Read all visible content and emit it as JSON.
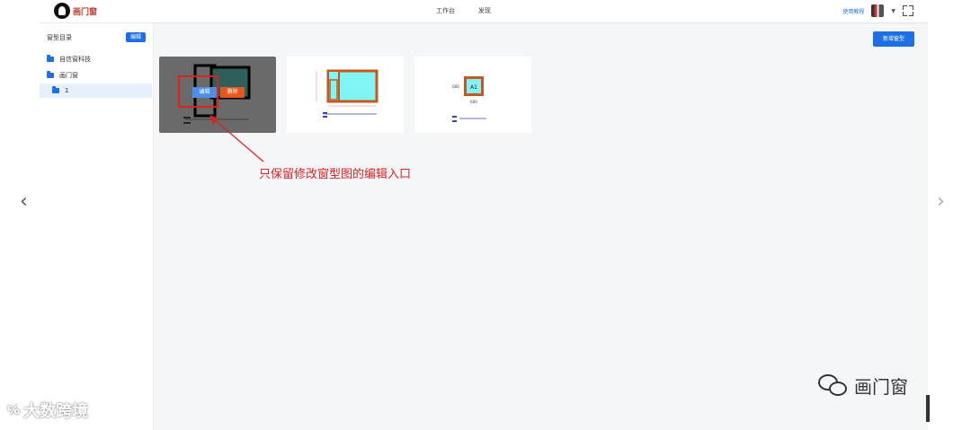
{
  "header": {
    "logo_text": "画门窗",
    "nav": [
      "工作台",
      "发现"
    ],
    "tutorial_link": "使用教程"
  },
  "sidebar": {
    "title": "窗型目录",
    "edit_label": "编辑",
    "items": [
      {
        "label": "自信窗科技",
        "active": false
      },
      {
        "label": "画门窗",
        "active": false
      },
      {
        "label": "1",
        "active": true
      }
    ]
  },
  "main": {
    "new_button_label": "新增窗型",
    "cards": [
      {
        "overlay_edit": "编辑",
        "overlay_delete": "删除"
      },
      {},
      {
        "sample_label": "A1",
        "size_label": "600"
      }
    ]
  },
  "annotation_text": "只保留修改窗型图的编辑入口",
  "watermarks": {
    "left": "大数跨境",
    "right": "画门窗"
  },
  "colors": {
    "accent": "#1e6fe6",
    "danger": "#e8561e",
    "annotation": "#e02020",
    "glass": "#7ff5f5",
    "frame": "#c8571e"
  },
  "icons": {
    "nav_prev": "chevron-left-icon",
    "nav_next": "chevron-right-icon",
    "fullscreen": "fullscreen-icon",
    "folder": "folder-icon"
  }
}
